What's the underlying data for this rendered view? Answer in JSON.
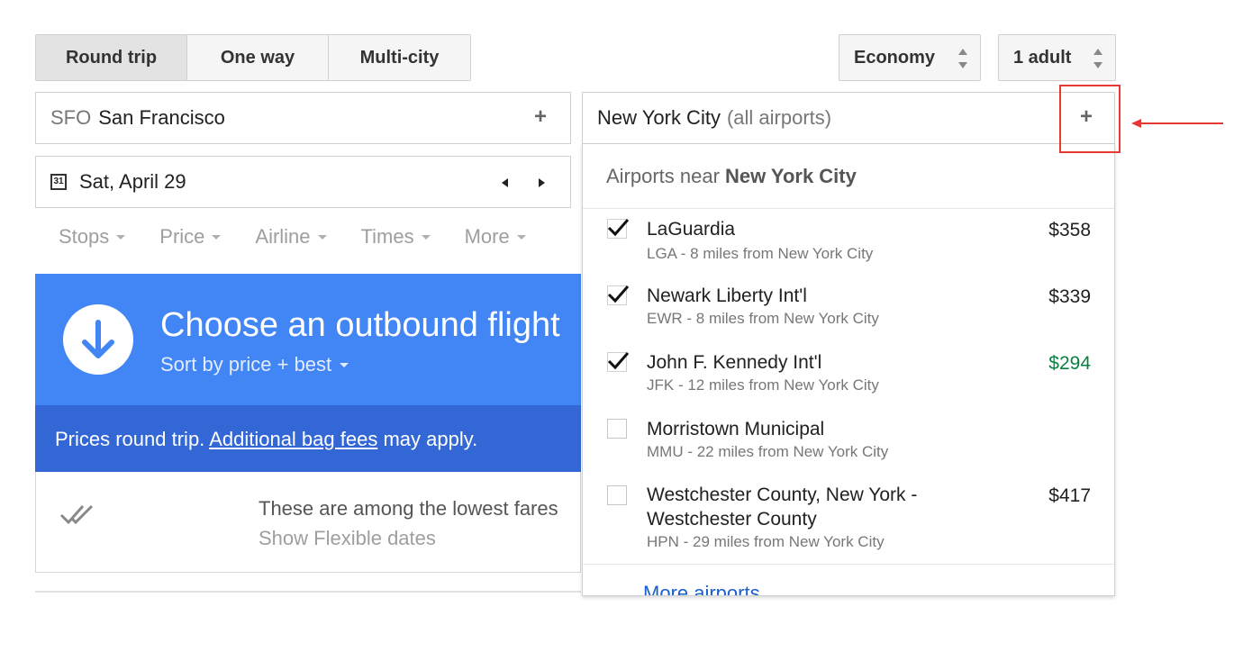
{
  "trip_types": [
    "Round trip",
    "One way",
    "Multi-city"
  ],
  "cabin": "Economy",
  "passengers": "1 adult",
  "origin": {
    "code": "SFO",
    "city": "San Francisco"
  },
  "destination": {
    "city": "New York City",
    "suffix": "(all airports)"
  },
  "date": "Sat, April 29",
  "calendar_icon_text": "31",
  "filters": [
    "Stops",
    "Price",
    "Airline",
    "Times",
    "More"
  ],
  "banner": {
    "title": "Choose an outbound flight",
    "sort": "Sort by price + best"
  },
  "notice": {
    "prefix": "Prices round trip. ",
    "link": "Additional bag fees",
    "suffix": " may apply."
  },
  "lowest_fares": {
    "text": "These are among the lowest fares",
    "link": "Show Flexible dates"
  },
  "dropdown": {
    "header_prefix": "Airports near",
    "header_city": "New York City",
    "airports": [
      {
        "name": "LaGuardia",
        "detail": "LGA - 8 miles from New York City",
        "price": "$358",
        "checked": true
      },
      {
        "name": "Newark Liberty Int'l",
        "detail": "EWR - 8 miles from New York City",
        "price": "$339",
        "checked": true
      },
      {
        "name": "John F. Kennedy Int'l",
        "detail": "JFK - 12 miles from New York City",
        "price": "$294",
        "checked": true
      },
      {
        "name": "Morristown Municipal",
        "detail": "MMU - 22 miles from New York City",
        "price": "",
        "checked": false
      },
      {
        "name": "Westchester County, New York -",
        "name2": "Westchester County",
        "detail": "HPN - 29 miles from New York City",
        "price": "$417",
        "checked": false
      }
    ],
    "more_link": "More airports"
  },
  "colors": {
    "primary": "#4285f4",
    "primary_dark": "#3367d6",
    "lowest_price": "#0b8043",
    "annotation": "#e53935"
  }
}
